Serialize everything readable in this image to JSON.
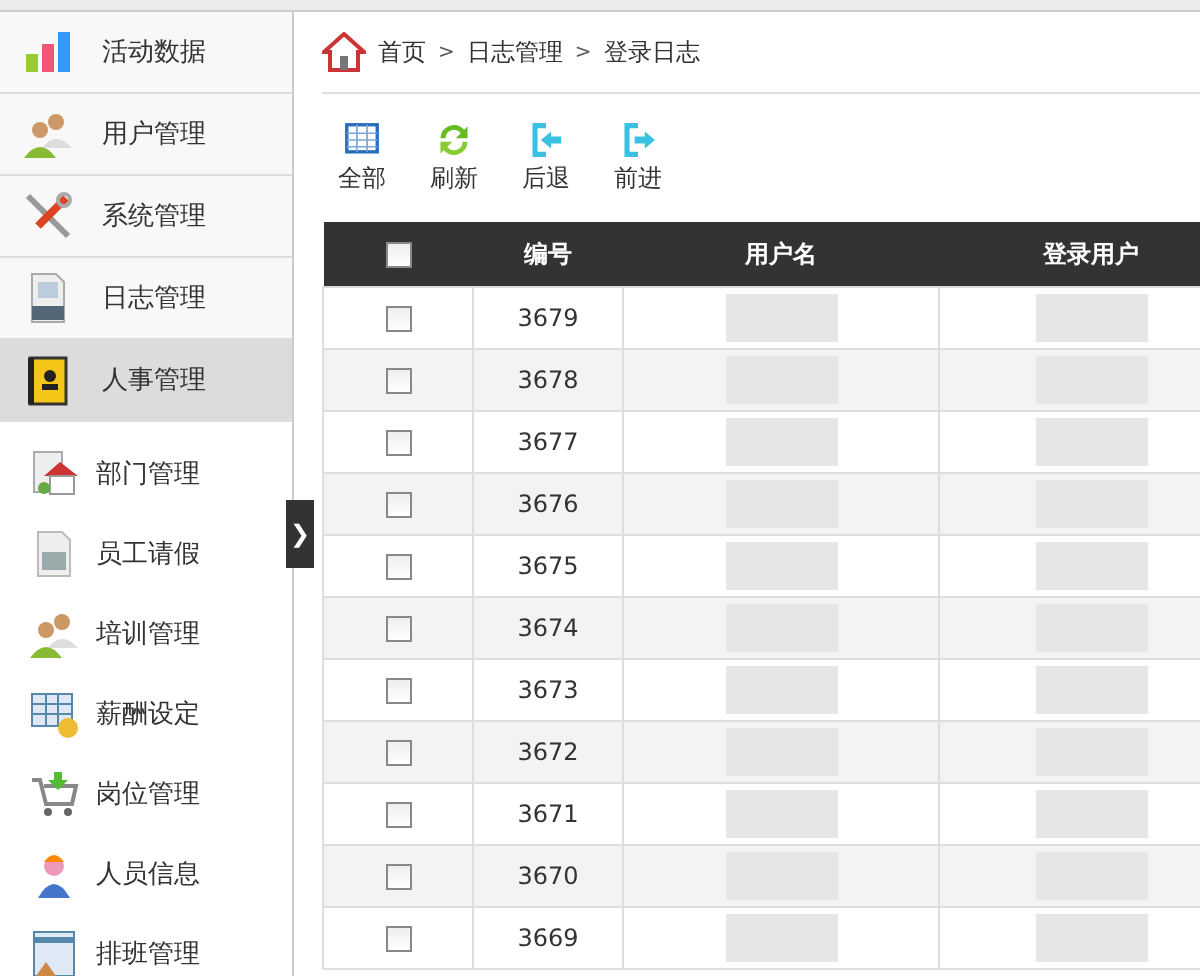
{
  "sidebar": {
    "menus": [
      {
        "label": "活动数据",
        "kind": "chart",
        "selected": false
      },
      {
        "label": "用户管理",
        "kind": "users",
        "selected": false
      },
      {
        "label": "系统管理",
        "kind": "tools",
        "selected": false
      },
      {
        "label": "日志管理",
        "kind": "log",
        "selected": false
      },
      {
        "label": "人事管理",
        "kind": "contacts",
        "selected": true
      }
    ],
    "submenu": [
      {
        "label": "部门管理",
        "kind": "house"
      },
      {
        "label": "员工请假",
        "kind": "sheet"
      },
      {
        "label": "培训管理",
        "kind": "users"
      },
      {
        "label": "薪酬设定",
        "kind": "salary"
      },
      {
        "label": "岗位管理",
        "kind": "cart"
      },
      {
        "label": "人员信息",
        "kind": "worker"
      },
      {
        "label": "排班管理",
        "kind": "schedule"
      }
    ],
    "collapse_toggle": "❯"
  },
  "breadcrumb": [
    "首页",
    "日志管理",
    "登录日志"
  ],
  "breadcrumb_separator": ">",
  "toolbar": [
    {
      "label": "全部",
      "kind": "grid"
    },
    {
      "label": "刷新",
      "kind": "refresh"
    },
    {
      "label": "后退",
      "kind": "back"
    },
    {
      "label": "前进",
      "kind": "forward"
    }
  ],
  "table": {
    "select_all_checked": false,
    "columns": [
      "编号",
      "用户名",
      "登录用户"
    ],
    "rows": [
      {
        "checked": false,
        "id": "3679"
      },
      {
        "checked": false,
        "id": "3678"
      },
      {
        "checked": false,
        "id": "3677"
      },
      {
        "checked": false,
        "id": "3676"
      },
      {
        "checked": false,
        "id": "3675"
      },
      {
        "checked": false,
        "id": "3674"
      },
      {
        "checked": false,
        "id": "3673"
      },
      {
        "checked": false,
        "id": "3672"
      },
      {
        "checked": false,
        "id": "3671"
      },
      {
        "checked": false,
        "id": "3670"
      },
      {
        "checked": false,
        "id": "3669"
      }
    ]
  }
}
